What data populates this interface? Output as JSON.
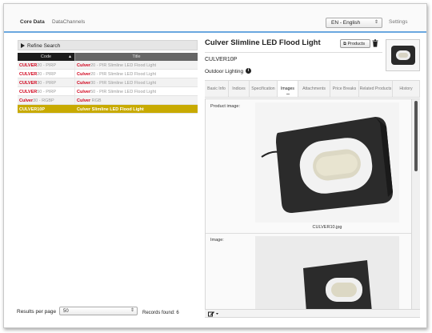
{
  "nav": {
    "core_data": "Core Data",
    "data_channels": "DataChannels",
    "language": "EN - English",
    "settings": "Settings"
  },
  "left": {
    "refine_label": "Refine Search",
    "columns": {
      "code": "Code",
      "title": "Title"
    },
    "rows": [
      {
        "code_hl": "CULVER",
        "code_rest": "20 - PIRP",
        "title_hl": "Culver",
        "title_rest": "20 - PIR Slimline LED Flood Light"
      },
      {
        "code_hl": "CULVER",
        "code_rest": "20 - PIRP",
        "title_hl": "Culver",
        "title_rest": "20 - PIR Slimline LED Flood Light"
      },
      {
        "code_hl": "CULVER",
        "code_rest": "30 - PIRP",
        "title_hl": "Culver",
        "title_rest": "30 - PIR Slimline LED Flood Light"
      },
      {
        "code_hl": "CULVER",
        "code_rest": "50 - PIRP",
        "title_hl": "Culver",
        "title_rest": "50 - PIR Slimline LED Flood Light"
      },
      {
        "code_hl": "Culver",
        "code_rest": "30 - RGBP",
        "title_hl": "Culver",
        "title_rest": " RGB"
      },
      {
        "code_hl": "",
        "code_rest": "CULVER10P",
        "title_hl": "",
        "title_rest": "Culver Slimline LED Flood Light",
        "selected": true
      }
    ],
    "results_per_page_label": "Results per page",
    "results_per_page_value": "50",
    "records_found": "Records found: 6"
  },
  "product": {
    "title": "Culver Slimline LED Flood Light",
    "products_button": "Products",
    "code": "CULVER10P",
    "category": "Outdoor Lighting",
    "info_glyph": "i",
    "tabs": [
      {
        "label": "Basic Info"
      },
      {
        "label": "Indices"
      },
      {
        "label": "Specification"
      },
      {
        "label": "Images",
        "active": true
      },
      {
        "label": "Attachments"
      },
      {
        "label": "Price Breaks"
      },
      {
        "label": "Related Products"
      },
      {
        "label": "History"
      }
    ],
    "product_image_label": "Product image:",
    "image_caption": "CULVER10.jpg",
    "image_label": "Image:"
  },
  "icons": {
    "trash": "trash-icon",
    "sort": "sort-icon",
    "edit": "edit-icon",
    "products": "products-icon"
  },
  "colors": {
    "highlight_red": "#d0021b",
    "selected_row": "#c8aa00",
    "nav_accent": "#6aa8df"
  }
}
